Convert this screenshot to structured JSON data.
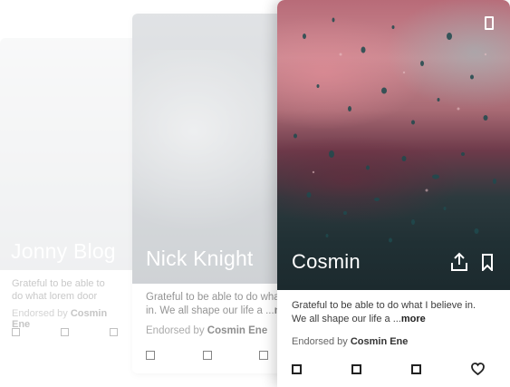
{
  "cards": [
    {
      "name": "Jonny Blog",
      "description_lines": [
        "Grateful to be able to",
        "do what lorem door"
      ],
      "endorsed_prefix": "Endorsed by ",
      "endorser": "Cosmin Ene"
    },
    {
      "name": "Nick Knight",
      "description_lines": [
        "Grateful to be able to do what",
        "in. We all shape our life a ..."
      ],
      "more_label": "more",
      "endorsed_prefix": "Endorsed by ",
      "endorser": "Cosmin Ene"
    },
    {
      "name": "Cosmin",
      "description_lines": [
        "Grateful to be able to do what I believe in.",
        "We all shape our life a ..."
      ],
      "more_label": "more",
      "endorsed_prefix": "Endorsed by ",
      "endorser": "Cosmin Ene"
    }
  ],
  "icons": {
    "top_right": "phone-icon",
    "share": "share-icon",
    "bookmark": "bookmark-icon",
    "action_squares": "square-icon",
    "like": "heart-icon"
  },
  "colors": {
    "name_text": "#ffffff",
    "icon_dark": "#222222",
    "endorser_text": "#333333"
  }
}
